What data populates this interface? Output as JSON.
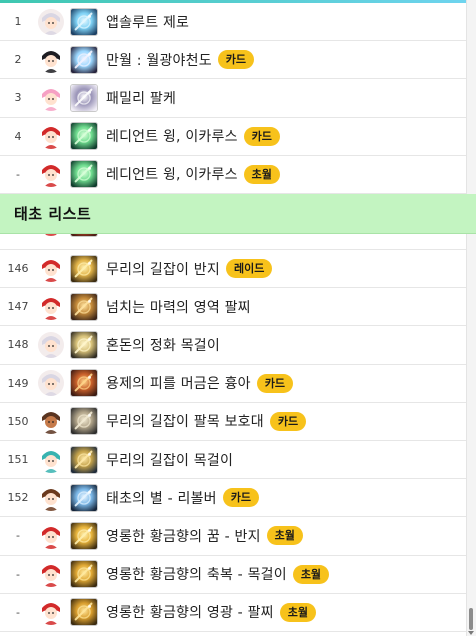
{
  "section": {
    "title": "태초 리스트"
  },
  "top_rows": [
    {
      "rank": "1",
      "name": "앱솔루트 제로",
      "badge": "",
      "avatar": "white-hair-girl-avatar",
      "icon": "blue-spear-icon"
    },
    {
      "rank": "2",
      "name": "만월 : 월광야천도",
      "badge": "카드",
      "avatar": "black-hair-boy-avatar",
      "icon": "crescent-blade-icon"
    },
    {
      "rank": "3",
      "name": "패밀리 팔케",
      "badge": "",
      "avatar": "pink-hair-girl-avatar",
      "icon": "ribbon-bracelet-icon"
    },
    {
      "rank": "4",
      "name": "레디언트 윙, 이카루스",
      "badge": "카드",
      "avatar": "santa-hat-avatar",
      "icon": "green-wing-icon"
    },
    {
      "rank": "-",
      "name": "레디언트 윙, 이카루스",
      "badge": "초월",
      "avatar": "santa-hat-avatar",
      "icon": "green-wing-icon"
    }
  ],
  "bottom_rows": [
    {
      "rank": "",
      "name": "",
      "badge": "",
      "avatar": "santa-hat-avatar",
      "icon": "partial-item-icon",
      "cut": true
    },
    {
      "rank": "146",
      "name": "무리의 길잡이 반지",
      "badge": "레이드",
      "avatar": "santa-hat-avatar",
      "icon": "golden-ring-icon"
    },
    {
      "rank": "147",
      "name": "넘치는 마력의 영역 팔찌",
      "badge": "",
      "avatar": "santa-hat-avatar",
      "icon": "swirl-bracelet-icon"
    },
    {
      "rank": "148",
      "name": "혼돈의 정화 목걸이",
      "badge": "",
      "avatar": "white-hair-girl-avatar",
      "icon": "chaos-necklace-icon"
    },
    {
      "rank": "149",
      "name": "용제의 피를 머금은 흉아",
      "badge": "카드",
      "avatar": "white-hair-girl-avatar",
      "icon": "dragon-fang-icon"
    },
    {
      "rank": "150",
      "name": "무리의 길잡이 팔목 보호대",
      "badge": "카드",
      "avatar": "tanned-man-avatar",
      "icon": "wrist-guard-icon"
    },
    {
      "rank": "151",
      "name": "무리의 길잡이 목걸이",
      "badge": "",
      "avatar": "teal-hair-girl-avatar",
      "icon": "leader-necklace-icon"
    },
    {
      "rank": "152",
      "name": "태초의 별 - 리볼버",
      "badge": "카드",
      "avatar": "brown-hair-girl-avatar",
      "icon": "revolver-icon"
    },
    {
      "rank": "-",
      "name": "영롱한 황금향의 꿈 - 반지",
      "badge": "초월",
      "avatar": "santa-hat-avatar",
      "icon": "gold-ring-dream-icon"
    },
    {
      "rank": "-",
      "name": "영롱한 황금향의 축복 - 목걸이",
      "badge": "초월",
      "avatar": "santa-hat-avatar",
      "icon": "gold-necklace-icon"
    },
    {
      "rank": "-",
      "name": "영롱한 황금향의 영광 - 팔찌",
      "badge": "초월",
      "avatar": "santa-hat-avatar",
      "icon": "gold-bracelet-icon"
    }
  ],
  "colors": {
    "badge": "#f7c21b",
    "section_bg": "#c3f4c1",
    "accent": "#3ec7b0"
  }
}
